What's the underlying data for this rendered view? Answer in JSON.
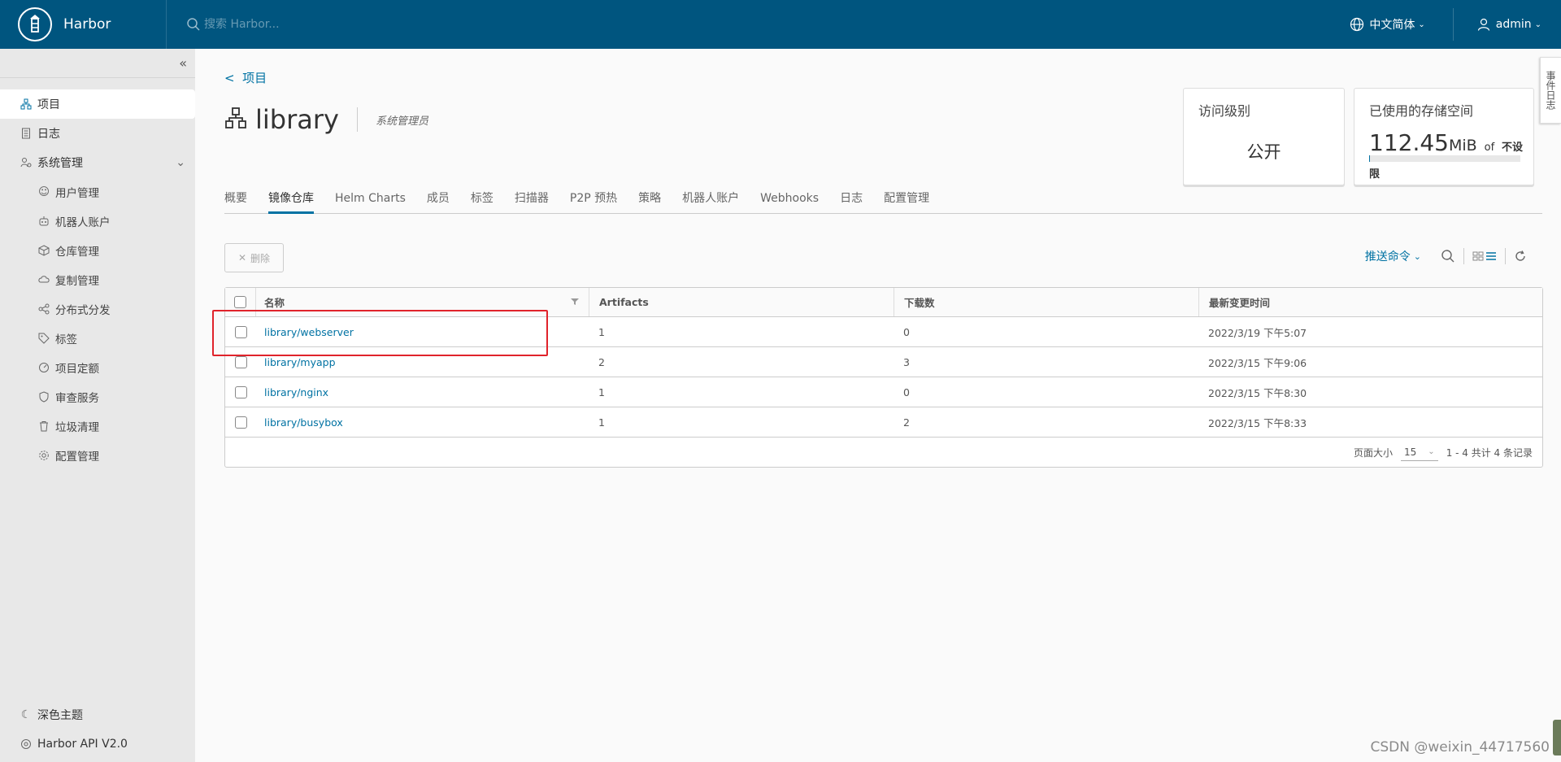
{
  "header": {
    "brand": "Harbor",
    "search_placeholder": "搜索 Harbor...",
    "language": "中文简体",
    "user": "admin"
  },
  "sidebar": {
    "items": [
      {
        "label": "项目",
        "icon": "projects-icon"
      },
      {
        "label": "日志",
        "icon": "log-icon"
      },
      {
        "label": "系统管理",
        "icon": "admin-icon"
      },
      {
        "label": "用户管理",
        "icon": "users-icon"
      },
      {
        "label": "机器人账户",
        "icon": "robot-icon"
      },
      {
        "label": "仓库管理",
        "icon": "registry-icon"
      },
      {
        "label": "复制管理",
        "icon": "replication-icon"
      },
      {
        "label": "分布式分发",
        "icon": "distribution-icon"
      },
      {
        "label": "标签",
        "icon": "tag-icon"
      },
      {
        "label": "项目定额",
        "icon": "quota-icon"
      },
      {
        "label": "审查服务",
        "icon": "shield-icon"
      },
      {
        "label": "垃圾清理",
        "icon": "trash-icon"
      },
      {
        "label": "配置管理",
        "icon": "gear-icon"
      }
    ],
    "bottom": [
      {
        "label": "深色主题",
        "icon": "moon-icon"
      },
      {
        "label": "Harbor API V2.0",
        "icon": "api-icon"
      }
    ]
  },
  "page": {
    "back_label": "项目",
    "title": "library",
    "role": "系统管理员"
  },
  "cards": {
    "access": {
      "title": "访问级别",
      "value": "公开"
    },
    "storage": {
      "title": "已使用的存储空间",
      "value": "112.45",
      "unit": "MiB",
      "of": "of",
      "limit": "不设限"
    }
  },
  "tabs": [
    "概要",
    "镜像仓库",
    "Helm Charts",
    "成员",
    "标签",
    "扫描器",
    "P2P 预热",
    "策略",
    "机器人账户",
    "Webhooks",
    "日志",
    "配置管理"
  ],
  "toolbar": {
    "delete_label": "删除",
    "push_command": "推送命令"
  },
  "table": {
    "headers": {
      "name": "名称",
      "artifacts": "Artifacts",
      "downloads": "下载数",
      "time": "最新变更时间"
    },
    "rows": [
      {
        "name": "library/webserver",
        "artifacts": "1",
        "downloads": "0",
        "time": "2022/3/19 下午5:07"
      },
      {
        "name": "library/myapp",
        "artifacts": "2",
        "downloads": "3",
        "time": "2022/3/15 下午9:06"
      },
      {
        "name": "library/nginx",
        "artifacts": "1",
        "downloads": "0",
        "time": "2022/3/15 下午8:30"
      },
      {
        "name": "library/busybox",
        "artifacts": "1",
        "downloads": "2",
        "time": "2022/3/15 下午8:33"
      }
    ],
    "footer": {
      "page_size_label": "页面大小",
      "page_size": "15",
      "summary": "1 - 4 共计 4 条记录"
    }
  },
  "event_log_tab": "事件日志",
  "watermark": "CSDN @weixin_44717560",
  "colors": {
    "header": "#00557f",
    "accent": "#0072a3",
    "highlight": "#e0232b"
  }
}
